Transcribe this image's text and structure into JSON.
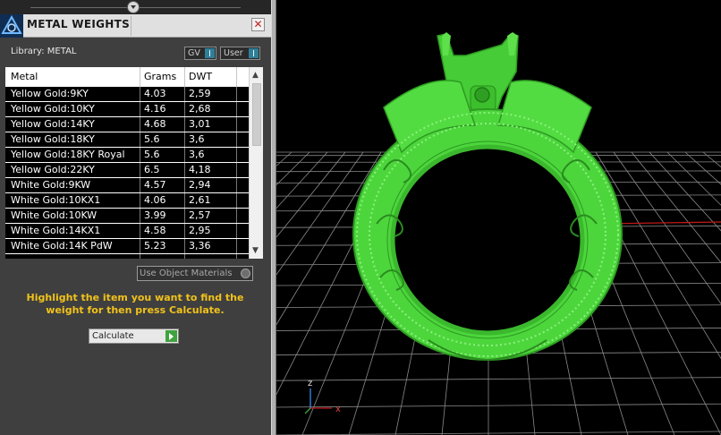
{
  "panel": {
    "title": "METAL WEIGHTS",
    "close_glyph": "✕",
    "library_label": "Library: METAL",
    "buttons": {
      "gv": "GV",
      "user": "User"
    },
    "columns": [
      "Metal",
      "Grams",
      "DWT"
    ],
    "rows": [
      {
        "metal": "Yellow Gold:9KY",
        "grams": "4.03",
        "dwt": "2,59"
      },
      {
        "metal": "Yellow Gold:10KY",
        "grams": "4.16",
        "dwt": "2,68"
      },
      {
        "metal": "Yellow Gold:14KY",
        "grams": "4.68",
        "dwt": "3,01"
      },
      {
        "metal": "Yellow Gold:18KY",
        "grams": "5.6",
        "dwt": "3,6"
      },
      {
        "metal": "Yellow Gold:18KY Royal",
        "grams": "5.6",
        "dwt": "3,6"
      },
      {
        "metal": "Yellow Gold:22KY",
        "grams": "6.5",
        "dwt": "4,18"
      },
      {
        "metal": "White Gold:9KW",
        "grams": "4.57",
        "dwt": "2,94"
      },
      {
        "metal": "White Gold:10KX1",
        "grams": "4.06",
        "dwt": "2,61"
      },
      {
        "metal": "White Gold:10KW",
        "grams": "3.99",
        "dwt": "2,57"
      },
      {
        "metal": "White Gold:14KX1",
        "grams": "4.58",
        "dwt": "2,95"
      },
      {
        "metal": "White Gold:14K PdW",
        "grams": "5.23",
        "dwt": "3,36"
      },
      {
        "metal": "",
        "grams": "",
        "dwt": ""
      }
    ],
    "use_object_materials": "Use Object Materials",
    "instructions": "Highlight the item you want to find the weight for then press Calculate.",
    "calculate": "Calculate"
  },
  "viewport": {
    "axis_labels": {
      "z": "z",
      "x": "x"
    },
    "model_color": "#4cd63c",
    "grid_color": "#8a8a8a",
    "axis_x_color": "#c01818",
    "axis_y_color": "#2aa6d6"
  },
  "colors": {
    "panel_bg": "#3f3f3f",
    "instruction_text": "#f1c21b"
  }
}
